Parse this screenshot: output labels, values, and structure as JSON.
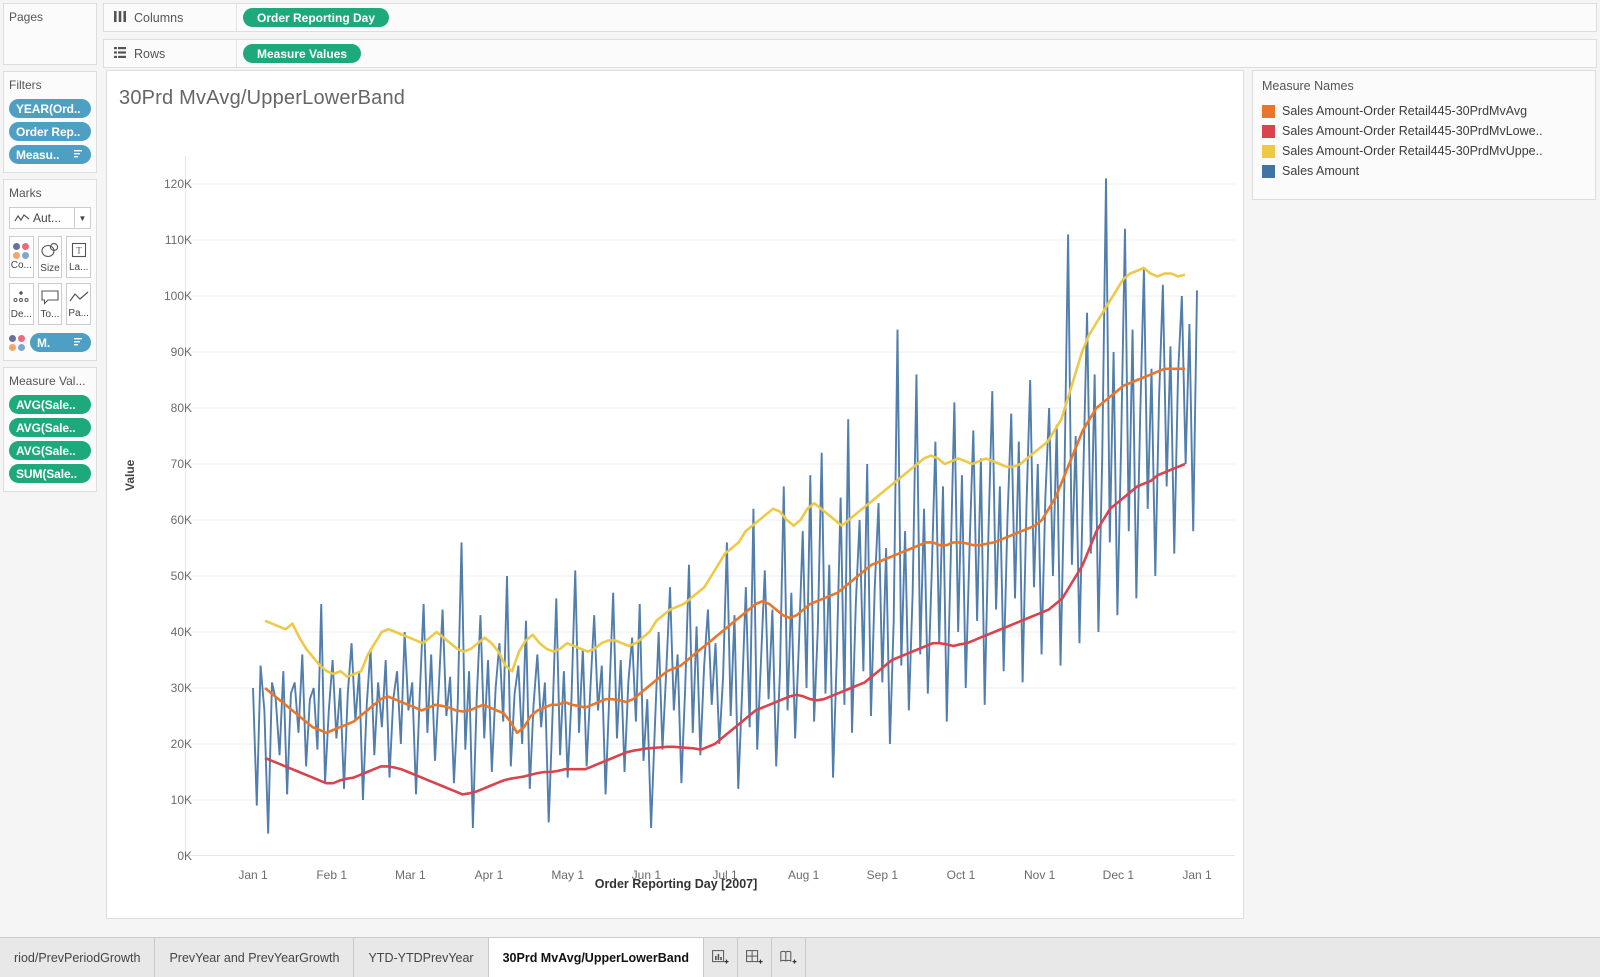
{
  "shelves": {
    "columns": {
      "label": "Columns",
      "icon": "columns-icon",
      "pill": "Order Reporting Day"
    },
    "rows": {
      "label": "Rows",
      "icon": "rows-icon",
      "pill": "Measure Values"
    }
  },
  "sidebar": {
    "pages": {
      "title": "Pages"
    },
    "filters": {
      "title": "Filters",
      "pills": [
        {
          "label": "YEAR(Ord..",
          "icon": ""
        },
        {
          "label": "Order Rep..",
          "icon": ""
        },
        {
          "label": "Measu..",
          "icon": "sort-icon"
        }
      ]
    },
    "marks": {
      "title": "Marks",
      "mark_type": "Aut...",
      "mark_type_icon": "line-chart-icon",
      "buttons": [
        {
          "label": "Co...",
          "icon": "color-dots-icon"
        },
        {
          "label": "Size",
          "icon": "size-icon"
        },
        {
          "label": "La...",
          "icon": "label-icon"
        },
        {
          "label": "De...",
          "icon": "detail-icon"
        },
        {
          "label": "To...",
          "icon": "tooltip-icon"
        },
        {
          "label": "Pa...",
          "icon": "path-icon"
        }
      ],
      "color_pill": {
        "label": "M.",
        "icon": "sort-icon"
      }
    },
    "measure_values": {
      "title": "Measure Val...",
      "pills": [
        "AVG(Sale..",
        "AVG(Sale..",
        "AVG(Sale..",
        "SUM(Sale.."
      ]
    }
  },
  "view": {
    "title": "30Prd MvAvg/UpperLowerBand"
  },
  "legend": {
    "title": "Measure Names",
    "items": [
      {
        "label": "Sales Amount-Order Retail445-30PrdMvAvg",
        "color": "#e8762c"
      },
      {
        "label": "Sales Amount-Order Retail445-30PrdMvLowe..",
        "color": "#d8434e"
      },
      {
        "label": "Sales Amount-Order Retail445-30PrdMvUppe..",
        "color": "#edc948"
      },
      {
        "label": "Sales Amount",
        "color": "#4373a5"
      }
    ]
  },
  "tabs": {
    "items": [
      {
        "label": "riod/PrevPeriodGrowth",
        "active": false
      },
      {
        "label": "PrevYear and PrevYearGrowth",
        "active": false
      },
      {
        "label": "YTD-YTDPrevYear",
        "active": false
      },
      {
        "label": "30Prd MvAvg/UpperLowerBand",
        "active": true
      }
    ],
    "buttons": [
      {
        "name": "new-worksheet-icon"
      },
      {
        "name": "new-dashboard-icon"
      },
      {
        "name": "new-story-icon"
      }
    ]
  },
  "chart_data": {
    "type": "line",
    "title": "30Prd MvAvg/UpperLowerBand",
    "xlabel": "Order Reporting Day [2007]",
    "ylabel": "Value",
    "ylim": [
      0,
      125000
    ],
    "yticks": [
      0,
      10000,
      20000,
      30000,
      40000,
      50000,
      60000,
      70000,
      80000,
      90000,
      100000,
      110000,
      120000
    ],
    "ytick_labels": [
      "0K",
      "10K",
      "20K",
      "30K",
      "40K",
      "50K",
      "60K",
      "70K",
      "80K",
      "90K",
      "100K",
      "110K",
      "120K"
    ],
    "xticks": [
      "Jan 1",
      "Feb 1",
      "Mar 1",
      "Apr 1",
      "May 1",
      "Jun 1",
      "Jul 1",
      "Aug 1",
      "Sep 1",
      "Oct 1",
      "Nov 1",
      "Dec 1",
      "Jan 1"
    ],
    "grid": true,
    "legend_position": "right",
    "series": [
      {
        "name": "Sales Amount",
        "color": "#4373a5",
        "note": "daily sales, highly volatile, 4K-121K range, rising through year",
        "values": [
          30000,
          9000,
          34000,
          26000,
          4000,
          31000,
          28000,
          18000,
          33000,
          11000,
          29000,
          31000,
          22000,
          36000,
          16000,
          28000,
          30000,
          19000,
          45000,
          13000,
          26000,
          35000,
          21000,
          30000,
          12000,
          29000,
          38000,
          24000,
          33000,
          10000,
          27000,
          37000,
          18000,
          31000,
          23000,
          35000,
          14000,
          28000,
          33000,
          20000,
          40000,
          26000,
          31000,
          11000,
          29000,
          45000,
          22000,
          36000,
          17000,
          30000,
          44000,
          25000,
          32000,
          13000,
          27000,
          56000,
          19000,
          33000,
          5000,
          28000,
          43000,
          21000,
          35000,
          15000,
          30000,
          38000,
          24000,
          50000,
          16000,
          29000,
          34000,
          20000,
          42000,
          12000,
          27000,
          36000,
          23000,
          31000,
          6000,
          25000,
          46000,
          18000,
          33000,
          14000,
          28000,
          51000,
          22000,
          37000,
          16000,
          30000,
          43000,
          26000,
          34000,
          11000,
          29000,
          47000,
          21000,
          35000,
          15000,
          31000,
          39000,
          24000,
          45000,
          17000,
          28000,
          5000,
          23000,
          40000,
          19000,
          33000,
          48000,
          26000,
          36000,
          13000,
          30000,
          52000,
          22000,
          41000,
          18000,
          34000,
          44000,
          27000,
          38000,
          20000,
          32000,
          56000,
          25000,
          43000,
          12000,
          29000,
          48000,
          23000,
          62000,
          19000,
          35000,
          51000,
          28000,
          44000,
          16000,
          33000,
          66000,
          26000,
          47000,
          21000,
          38000,
          58000,
          30000,
          68000,
          24000,
          41000,
          72000,
          29000,
          52000,
          14000,
          36000,
          64000,
          27000,
          78000,
          22000,
          45000,
          60000,
          33000,
          70000,
          25000,
          48000,
          63000,
          31000,
          55000,
          20000,
          42000,
          94000,
          34000,
          58000,
          26000,
          47000,
          86000,
          36000,
          62000,
          29000,
          50000,
          74000,
          38000,
          66000,
          24000,
          52000,
          81000,
          40000,
          68000,
          30000,
          55000,
          76000,
          42000,
          71000,
          27000,
          58000,
          83000,
          44000,
          66000,
          33000,
          60000,
          79000,
          46000,
          74000,
          31000,
          62000,
          85000,
          48000,
          70000,
          36000,
          64000,
          80000,
          50000,
          77000,
          34000,
          66000,
          111000,
          52000,
          75000,
          38000,
          68000,
          97000,
          54000,
          86000,
          40000,
          71000,
          121000,
          56000,
          90000,
          43000,
          74000,
          112000,
          58000,
          94000,
          46000,
          78000,
          105000,
          62000,
          87000,
          50000,
          82000,
          102000,
          66000,
          91000,
          54000,
          86000,
          100000,
          70000,
          95000,
          58000,
          101000
        ]
      },
      {
        "name": "Sales Amount-Order Retail445-30PrdMvUpperBand",
        "color": "#edc948",
        "note": "30-period moving upper band; starts ~42K, dips to ~32K in Feb, flat ~37-41K Mar-Jun, rises from ~45K in Jul to ~105K by late Dec",
        "values": [
          42000,
          41500,
          41000,
          40500,
          41500,
          39000,
          37000,
          35500,
          34000,
          33000,
          32500,
          33000,
          32000,
          32500,
          33000,
          36000,
          38000,
          40000,
          40500,
          40000,
          39500,
          39000,
          38500,
          38000,
          39000,
          40000,
          39000,
          38000,
          37000,
          36500,
          37000,
          38000,
          39000,
          38000,
          36500,
          34000,
          33000,
          36500,
          38500,
          39500,
          38000,
          37000,
          36500,
          37000,
          38000,
          37500,
          37000,
          36500,
          37000,
          38000,
          38500,
          38500,
          38000,
          37500,
          38000,
          39000,
          40000,
          42000,
          43000,
          44000,
          44500,
          45000,
          46000,
          47000,
          48000,
          50000,
          52000,
          54000,
          55000,
          56000,
          58000,
          59000,
          60000,
          61000,
          62000,
          61500,
          60000,
          59000,
          60000,
          62000,
          63000,
          62000,
          61000,
          60000,
          59000,
          60000,
          61000,
          62000,
          63000,
          64000,
          65000,
          66000,
          67000,
          68000,
          69000,
          70000,
          71000,
          71500,
          71000,
          70000,
          70500,
          71000,
          70500,
          70000,
          70500,
          71000,
          70500,
          70000,
          69500,
          69500,
          70000,
          71000,
          72000,
          73000,
          74000,
          76000,
          78000,
          82000,
          86000,
          90000,
          93000,
          95000,
          97000,
          99000,
          101000,
          103000,
          104000,
          104500,
          105000,
          104000,
          103500,
          104000,
          104000,
          103500,
          103800
        ]
      },
      {
        "name": "Sales Amount-Order Retail445-30PrdMvAvg",
        "color": "#e8762c",
        "note": "30-period moving average; starts ~30K, dips to ~22K Feb, gradual rise to ~87K by year end",
        "values": [
          30000,
          29000,
          28000,
          27000,
          26000,
          25000,
          24000,
          23000,
          22500,
          22000,
          22500,
          23000,
          23500,
          24000,
          25000,
          26000,
          27000,
          28000,
          28500,
          28000,
          27500,
          27000,
          26500,
          26000,
          26500,
          27000,
          26800,
          26500,
          26000,
          25800,
          26000,
          26500,
          27000,
          26500,
          26000,
          25500,
          24000,
          22000,
          23000,
          25000,
          26000,
          26500,
          27000,
          27000,
          27500,
          27000,
          26800,
          26500,
          27000,
          27500,
          28000,
          28000,
          27800,
          27500,
          28000,
          29000,
          30000,
          31000,
          32000,
          33000,
          33500,
          34000,
          35000,
          36000,
          37000,
          38000,
          39000,
          40000,
          41000,
          42000,
          43000,
          44000,
          45000,
          45500,
          45000,
          44000,
          43000,
          42500,
          43000,
          44000,
          45000,
          45500,
          46000,
          46500,
          47000,
          48000,
          49000,
          50000,
          51000,
          52000,
          52500,
          53000,
          53500,
          54000,
          54500,
          55000,
          55500,
          56000,
          56000,
          55500,
          55500,
          56000,
          56000,
          55800,
          55500,
          55500,
          55800,
          56000,
          56500,
          57000,
          57500,
          58000,
          58500,
          59000,
          60000,
          62000,
          64000,
          67000,
          70000,
          73000,
          76000,
          78000,
          80000,
          81000,
          82000,
          83000,
          84000,
          84500,
          85000,
          85500,
          86000,
          86500,
          87000,
          87000,
          87000,
          87000
        ]
      },
      {
        "name": "Sales Amount-Order Retail445-30PrdMvLowerBand",
        "color": "#d8434e",
        "note": "30-period moving lower band; starts ~17K, dips to ~11K Feb-Apr, slow climb to ~70K by year end",
        "values": [
          17500,
          17000,
          16500,
          16000,
          15500,
          15000,
          14500,
          14000,
          13500,
          13000,
          13000,
          13500,
          13800,
          14000,
          14500,
          15000,
          15500,
          16000,
          16000,
          15800,
          15500,
          15000,
          14500,
          14000,
          13500,
          13000,
          12500,
          12000,
          11500,
          11000,
          11200,
          11500,
          12000,
          12500,
          13000,
          13500,
          13800,
          14000,
          14200,
          14500,
          14800,
          15000,
          15000,
          15200,
          15500,
          15500,
          15500,
          15500,
          16000,
          16500,
          17000,
          17500,
          18000,
          18500,
          18800,
          19000,
          19200,
          19300,
          19400,
          19500,
          19500,
          19400,
          19300,
          19200,
          19000,
          19500,
          20000,
          21000,
          22000,
          23000,
          24000,
          25000,
          26000,
          26500,
          27000,
          27500,
          28000,
          28500,
          28800,
          28500,
          28000,
          27800,
          28000,
          28500,
          29000,
          29500,
          30000,
          30500,
          31000,
          32000,
          33000,
          34000,
          35000,
          35500,
          36000,
          36500,
          37000,
          37500,
          38000,
          38000,
          37800,
          37500,
          37800,
          38000,
          38500,
          39000,
          39500,
          40000,
          40500,
          41000,
          41500,
          42000,
          42500,
          43000,
          43500,
          44000,
          45000,
          46000,
          48000,
          50000,
          52000,
          55000,
          58000,
          60000,
          62000,
          63000,
          64000,
          65000,
          66000,
          66500,
          67000,
          68000,
          68500,
          69000,
          69500,
          70000
        ]
      }
    ]
  }
}
